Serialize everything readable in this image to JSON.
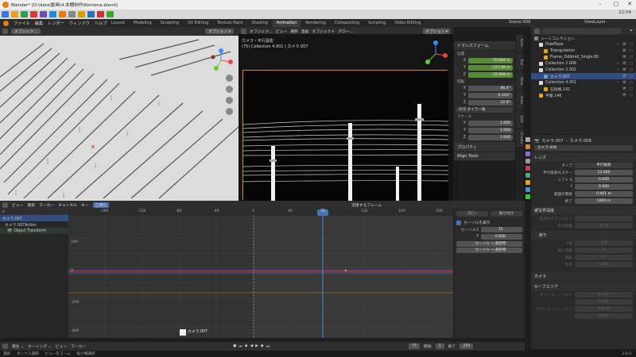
{
  "window": {
    "title": "Blender* [D:\\data\\動画\\4.本棚制作\\Kontena.blend]",
    "time": "22:04"
  },
  "menu": [
    "ファイル",
    "編集",
    "レンダー",
    "ウィンドウ",
    "ヘルプ"
  ],
  "workspaces": [
    "Layout",
    "Modeling",
    "Sculpting",
    "UV Editing",
    "Texture Paint",
    "Shading",
    "Animation",
    "Rendering",
    "Compositing",
    "Scripting",
    "Video Editing"
  ],
  "active_workspace": "Animation",
  "scene": "Scene.006",
  "view_layer": "ViewLayer",
  "left_viewport": {
    "mode": "オブジェク…",
    "options": "オプション ▾"
  },
  "camera_viewport": {
    "header_items": [
      "オブジェク…",
      "ビュー",
      "選択",
      "追加",
      "オブジェクト",
      "グロー…"
    ],
    "options": "オプション ▾",
    "title": "カメラ・平行投影",
    "subtitle": "(75) Collection 4.001 | カメラ.007"
  },
  "npanel": {
    "transform": "トランスフォーム",
    "location_label": "位置",
    "location": [
      {
        "axis": "X",
        "value": "70.684 m"
      },
      {
        "axis": "Y",
        "value": "-127.06 m"
      },
      {
        "axis": "Z",
        "value": "22.908 m"
      }
    ],
    "rotation_label": "回転",
    "rotation": [
      {
        "axis": "X",
        "value": "86.4°"
      },
      {
        "axis": "Y",
        "value": "0.203°"
      },
      {
        "axis": "Z",
        "value": "12.8°"
      }
    ],
    "rotation_mode": "XYZ オイラー角",
    "scale_label": "スケール",
    "scale": [
      {
        "axis": "X",
        "value": "1.000"
      },
      {
        "axis": "Y",
        "value": "1.000"
      },
      {
        "axis": "Z",
        "value": "1.000"
      }
    ],
    "properties": "プロパティ",
    "align_tools": "Align Tools"
  },
  "side_tabs": [
    "Item",
    "Tool",
    "View",
    "Auto",
    "Edit",
    "Create"
  ],
  "outliner": {
    "title": "シーンコレクション",
    "rows": [
      {
        "label": "PolePlaza",
        "indent": 1
      },
      {
        "label": "Triangulation",
        "indent": 2
      },
      {
        "label": "Frame_Oddmid_Single.80",
        "indent": 2
      },
      {
        "label": "Collection 2.006",
        "indent": 1
      },
      {
        "label": "Collection 3.002",
        "indent": 1
      },
      {
        "label": "カメラ.007",
        "indent": 2,
        "selected": true
      },
      {
        "label": "Collection 4.001",
        "indent": 1
      },
      {
        "label": "石垣根.142",
        "indent": 2
      },
      {
        "label": "平面.146",
        "indent": 1
      }
    ]
  },
  "properties": {
    "object": "カメラ.007",
    "data": "カメラ.008",
    "name": "カメラ.008",
    "lens_section": "レンズ",
    "type_label": "タイプ",
    "type": "平行投影",
    "ortho_label": "平行投影のスケー",
    "ortho": "12.400",
    "shift_x_label": "シフト X",
    "shift_x": "0.000",
    "shift_y_label": "Y",
    "shift_y": "0.000",
    "clip_start_label": "範囲の開始",
    "clip_start": "0.001 m",
    "clip_end_label": "終了",
    "clip_end": "1000 m",
    "dof_section": "被写界深度",
    "focus_label": "焦点のオブジェクト",
    "focus_dist_label": "焦点距離",
    "focus_dist": "10 m",
    "aperture_section": "絞り",
    "fstop_label": "F値",
    "fstop": "2.8",
    "blades_label": "絞り羽根",
    "blades": "0",
    "rotation_label": "回転",
    "rotation": "0°",
    "ratio_label": "比率",
    "ratio": "1.000",
    "camera_section": "カメラ",
    "safe_section": "セーフエリア",
    "title_safe_label": "タイトル…ーフエリ",
    "title_safe_x": "0.100",
    "title_safe_y": "0.050",
    "action_safe_label": "アクション…ーフエリ",
    "action_safe_x": "0.035",
    "action_safe_y": "0.035"
  },
  "graph_editor": {
    "header": [
      "ビュー",
      "選択",
      "マーカー",
      "チャンネル",
      "キー",
      "正規化"
    ],
    "filter": "近接するフレーム",
    "frame_ticks": [
      "-160",
      "-120",
      "-80",
      "-40",
      "0",
      "40",
      "75",
      "120",
      "160",
      "200"
    ],
    "value_ticks": [
      "200",
      "0",
      "-200",
      "-400"
    ],
    "current_frame": "75",
    "channels": [
      "カメラ.007",
      "カメラ.007Action",
      "Object Transform"
    ],
    "marker": "カメラ.007",
    "side": {
      "show_cursor": "カーソルを表示",
      "cursor_x_label": "カーソルX",
      "cursor_x": "75",
      "cursor_y_label": "Y",
      "cursor_y": "0.000",
      "btn1": "カーソル → 選択物",
      "btn2": "カーソル → 選択物",
      "copy": "コピー",
      "paste": "貼り付け"
    }
  },
  "timeline": {
    "items": [
      "再生 ⌄",
      "キーイング ⌄",
      "ビュー",
      "マーカー"
    ],
    "frame": "75",
    "start_label": "開始",
    "start": "1",
    "end_label": "終了",
    "end": "250"
  },
  "status": [
    "選択",
    "ボックス選択",
    "ビューをズーム",
    "投げ縄選択"
  ],
  "version": "3.0.0"
}
